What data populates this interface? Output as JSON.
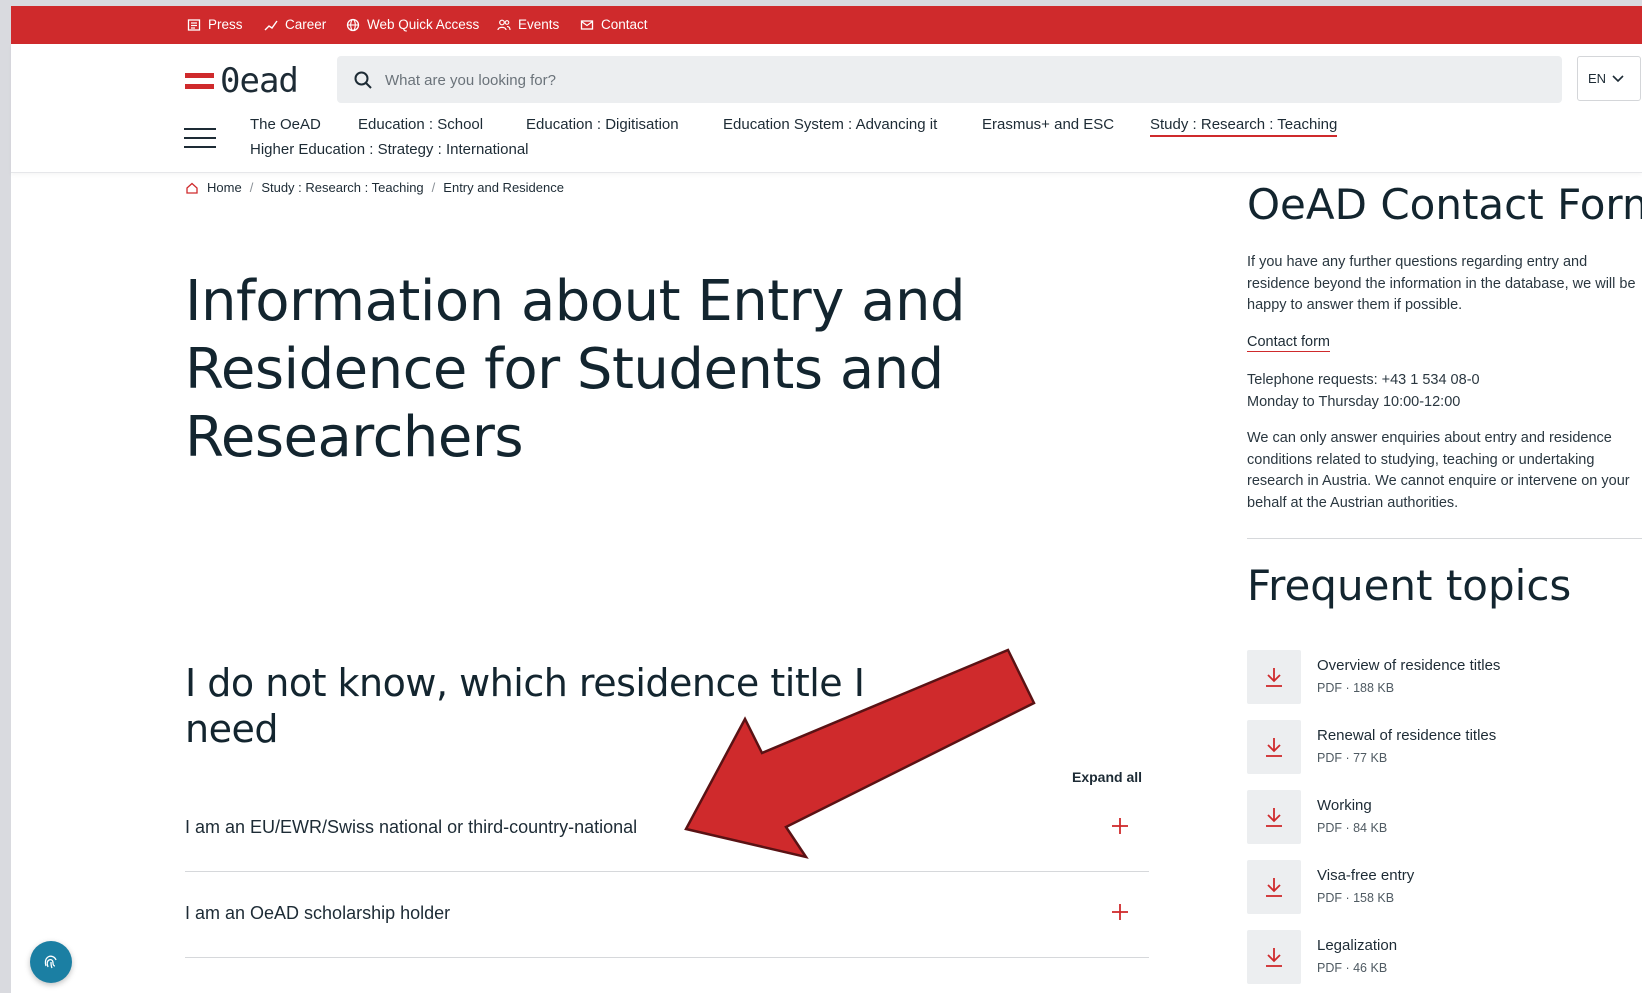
{
  "topbar": {
    "items": [
      {
        "label": "Press",
        "icon": "newspaper-icon"
      },
      {
        "label": "Career",
        "icon": "career-icon"
      },
      {
        "label": "Web Quick Access",
        "icon": "globe-icon"
      },
      {
        "label": "Events",
        "icon": "people-icon"
      },
      {
        "label": "Contact",
        "icon": "mail-icon"
      }
    ]
  },
  "header": {
    "logo_text": "0ead",
    "search_placeholder": "What are you looking for?",
    "language": "EN",
    "nav": [
      "The OeAD",
      "Education : School",
      "Education : Digitisation",
      "Education System : Advancing it",
      "Erasmus+ and ESC",
      "Study : Research : Teaching",
      "Higher Education : Strategy : International"
    ],
    "active_nav": "Study : Research : Teaching"
  },
  "breadcrumb": [
    "Home",
    "Study : Research : Teaching",
    "Entry and Residence"
  ],
  "main": {
    "title": "Information about Entry and Residence for Students and Researchers",
    "section_title": "I do not know, which residence title I need",
    "expand_all": "Expand all",
    "accordion": [
      "I am an EU/EWR/Swiss national or third-country-national",
      "I am an OeAD scholarship holder"
    ]
  },
  "sidebar": {
    "contact_title": "OeAD Contact Form",
    "intro": "If you have any further questions regarding entry and residence beyond the information in the database, we will be happy to answer them if possible.",
    "contact_link": "Contact form",
    "phone_line1": "Telephone requests: +43 1 534 08-0",
    "phone_line2": "Monday to Thursday 10:00-12:00",
    "disclaimer": "We can only answer enquiries about entry and residence conditions related to studying, teaching or undertaking research in Austria. We cannot enquire or intervene on your behalf at the Austrian authorities.",
    "topics_title": "Frequent topics",
    "topics": [
      {
        "name": "Overview of residence titles",
        "meta": "PDF · 188 KB"
      },
      {
        "name": "Renewal of residence titles",
        "meta": "PDF · 77 KB"
      },
      {
        "name": "Working",
        "meta": "PDF · 84 KB"
      },
      {
        "name": "Visa-free entry",
        "meta": "PDF · 158 KB"
      },
      {
        "name": "Legalization",
        "meta": "PDF · 46 KB"
      }
    ]
  },
  "colors": {
    "brand_red": "#cf2a2c",
    "text_dark": "#13252f",
    "cookie_blue": "#1b7fa3"
  }
}
